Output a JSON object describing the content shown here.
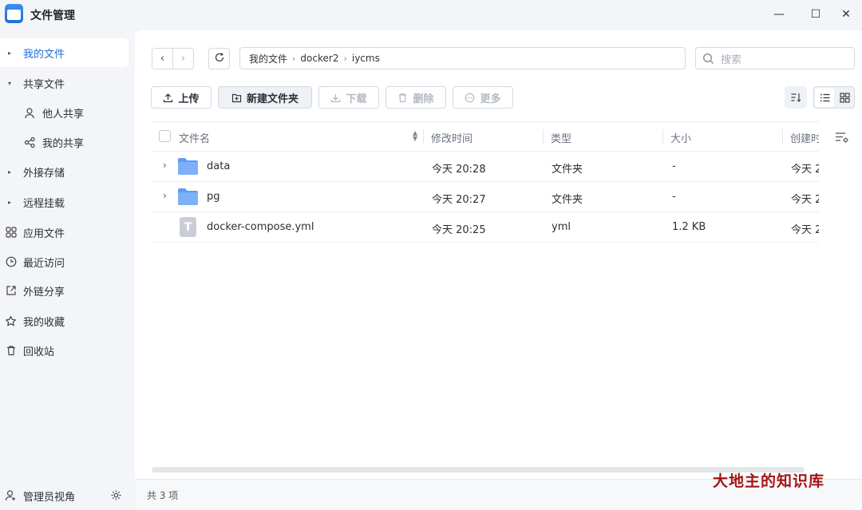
{
  "app": {
    "title": "文件管理"
  },
  "window_controls": {
    "minimize": "—",
    "maximize": "☐",
    "close": "✕"
  },
  "sidebar": {
    "items": [
      {
        "label": "我的文件"
      },
      {
        "label": "共享文件"
      },
      {
        "label": "他人共享"
      },
      {
        "label": "我的共享"
      },
      {
        "label": "外接存储"
      },
      {
        "label": "远程挂载"
      },
      {
        "label": "应用文件"
      },
      {
        "label": "最近访问"
      },
      {
        "label": "外链分享"
      },
      {
        "label": "我的收藏"
      },
      {
        "label": "回收站"
      }
    ],
    "footer_label": "管理员视角"
  },
  "breadcrumb": [
    "我的文件",
    "docker2",
    "iycms"
  ],
  "search": {
    "placeholder": "搜索"
  },
  "toolbar": {
    "upload": "上传",
    "new_folder": "新建文件夹",
    "download": "下载",
    "delete": "删除",
    "more": "更多"
  },
  "table": {
    "headers": {
      "name": "文件名",
      "modified": "修改时间",
      "type": "类型",
      "size": "大小",
      "created": "创建时"
    },
    "rows": [
      {
        "name": "data",
        "modified": "今天 20:28",
        "type": "文件夹",
        "size": "-",
        "created": "今天 2",
        "kind": "folder"
      },
      {
        "name": "pg",
        "modified": "今天 20:27",
        "type": "文件夹",
        "size": "-",
        "created": "今天 2",
        "kind": "folder"
      },
      {
        "name": "docker-compose.yml",
        "modified": "今天 20:25",
        "type": "yml",
        "size": "1.2 KB",
        "created": "今天 2",
        "kind": "file"
      }
    ]
  },
  "status": {
    "count_text": "共 3 项"
  },
  "watermark": "大地主的知识库",
  "colors": {
    "accent": "#1f6fd6",
    "folder": "#6aa3f7",
    "watermark": "#a31616"
  }
}
